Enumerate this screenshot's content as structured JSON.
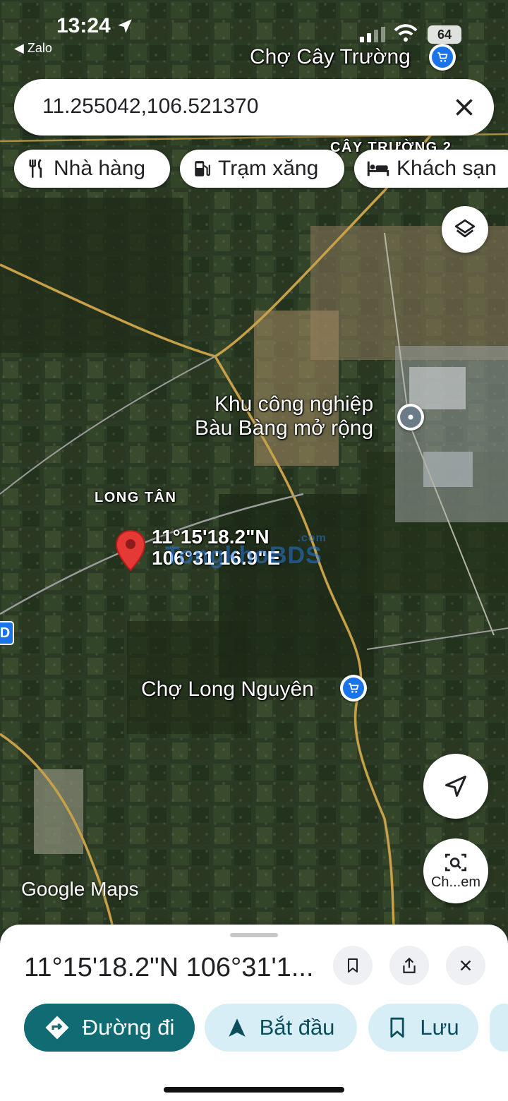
{
  "status_bar": {
    "time": "13:24",
    "back_app": "◀ Zalo",
    "battery": "64"
  },
  "search": {
    "query": "11.255042,106.521370"
  },
  "chips": [
    {
      "label": "Nhà hàng",
      "icon": "restaurant-icon"
    },
    {
      "label": "Trạm xăng",
      "icon": "gas-station-icon"
    },
    {
      "label": "Khách sạn",
      "icon": "hotel-icon"
    }
  ],
  "map": {
    "labels": {
      "cho_cay_truong": "Chợ Cây Trường",
      "cay_truong_2": "CÂY TRƯỜNG 2",
      "kcn_line1": "Khu công nghiệp",
      "kcn_line2": "Bàu Bàng mở rộng",
      "long_tan": "LONG TÂN",
      "cho_long_nguyen": "Chợ Long Nguyên"
    },
    "pin": {
      "lat_text": "11°15'18.2\"N",
      "lng_text": "106°31'16.9\"E"
    },
    "watermark": "TongkhoBDS",
    "watermark_suffix": ".com",
    "attribution": "Google Maps",
    "left_edge_badge": "D"
  },
  "controls": {
    "layers": "layers-icon",
    "my_location": "navigation-arrow-icon",
    "lens_label": "Ch...em"
  },
  "sheet": {
    "title": "11°15'18.2\"N 106°31'1...",
    "actions": [
      {
        "label": "Đường đi",
        "icon": "directions-icon"
      },
      {
        "label": "Bắt đầu",
        "icon": "navigation-icon"
      },
      {
        "label": "Lưu",
        "icon": "bookmark-icon"
      }
    ]
  },
  "colors": {
    "primary_button": "#106b73",
    "secondary_button": "#d7eef7",
    "poi_blue": "#1a73e8",
    "pin_red": "#e53935"
  }
}
